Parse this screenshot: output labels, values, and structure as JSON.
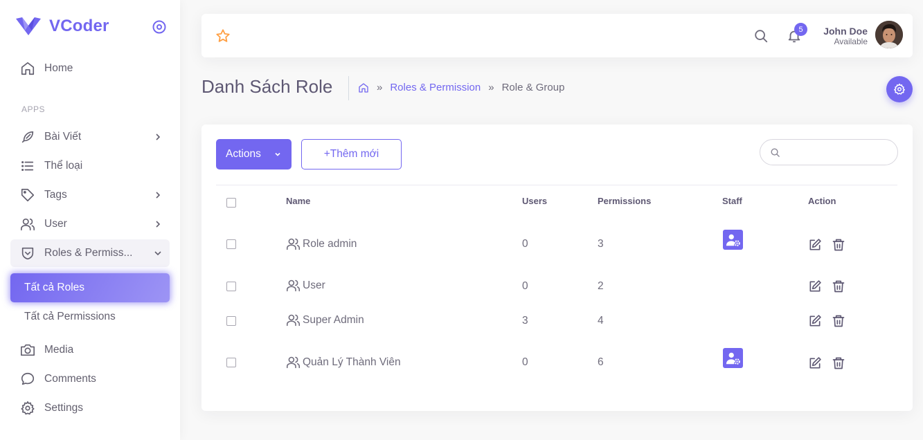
{
  "brand": {
    "name": "VCoder"
  },
  "sidebar": {
    "section_label": "APPS",
    "items": [
      {
        "label": "Home",
        "icon": "home-icon"
      },
      {
        "label": "Bài Viết",
        "icon": "feather-icon"
      },
      {
        "label": "Thể loại",
        "icon": "list-icon"
      },
      {
        "label": "Tags",
        "icon": "tag-icon"
      },
      {
        "label": "User",
        "icon": "users-icon"
      },
      {
        "label": "Roles & Permiss...",
        "icon": "shield-icon"
      },
      {
        "label": "Media",
        "icon": "camera-icon"
      },
      {
        "label": "Comments",
        "icon": "comment-icon"
      },
      {
        "label": "Settings",
        "icon": "gear-icon"
      }
    ],
    "sub_items": [
      {
        "label": "Tất cả Roles"
      },
      {
        "label": "Tất cả Permissions"
      }
    ]
  },
  "navbar": {
    "notification_count": "5",
    "user_name": "John Doe",
    "user_status": "Available"
  },
  "header": {
    "title": "Danh Sách Role",
    "breadcrumb": [
      "Roles & Permission",
      "Role & Group"
    ],
    "separator": "»"
  },
  "toolbar": {
    "actions_label": "Actions",
    "add_label": "+Thêm mới",
    "search_placeholder": ""
  },
  "table": {
    "columns": [
      "Name",
      "Users",
      "Permissions",
      "Staff",
      "Action"
    ],
    "rows": [
      {
        "name": "Role admin",
        "users": "0",
        "permissions": "3",
        "staff": true
      },
      {
        "name": "User",
        "users": "0",
        "permissions": "2",
        "staff": false
      },
      {
        "name": "Super Admin",
        "users": "3",
        "permissions": "4",
        "staff": false
      },
      {
        "name": "Quản Lý Thành Viên",
        "users": "0",
        "permissions": "6",
        "staff": true
      }
    ]
  },
  "colors": {
    "primary": "#7367f0",
    "star": "#ff9f43"
  }
}
